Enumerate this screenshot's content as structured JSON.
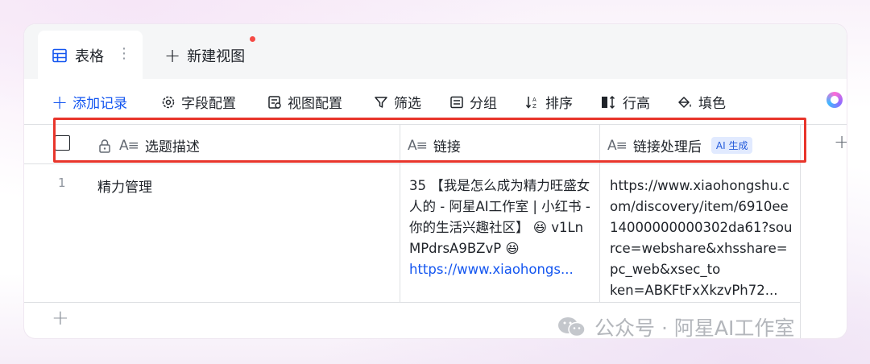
{
  "tabs": {
    "active_label": "表格",
    "more_glyph": "⋮",
    "new_view_label": "新建视图"
  },
  "toolbar": {
    "add_record": "添加记录",
    "field_config": "字段配置",
    "view_config": "视图配置",
    "filter": "筛选",
    "group": "分组",
    "sort": "排序",
    "row_height": "行高",
    "fill_color": "填色"
  },
  "table": {
    "columns": [
      {
        "label": "选题描述",
        "type_icon": "text-field-icon",
        "locked": true
      },
      {
        "label": "链接",
        "type_icon": "text-field-icon"
      },
      {
        "label": "链接处理后",
        "type_icon": "text-field-icon",
        "badge": "AI 生成"
      }
    ],
    "rows": [
      {
        "index": "1",
        "topic": "精力管理",
        "link_text": "35 【我是怎么成为精力旺盛女人的 - 阿星AI工作室 | 小红书 - 你的生活兴趣社区】 😆 v1LnMPdrsA9BZvP 😆",
        "link_url": "https://www.xiaohongs...",
        "processed": "https://www.xiaohongshu.com/discovery/item/6910ee14000000000302da61?source=webshare&xhsshare=pc_web&xsec_to",
        "processed_last": "ken=ABKFtFxXkzvPh72..."
      }
    ]
  },
  "watermark": "公众号 · 阿星AI工作室",
  "colors": {
    "accent": "#1456f0",
    "highlight_box": "#e8352b",
    "notify_dot": "#f54a45"
  }
}
